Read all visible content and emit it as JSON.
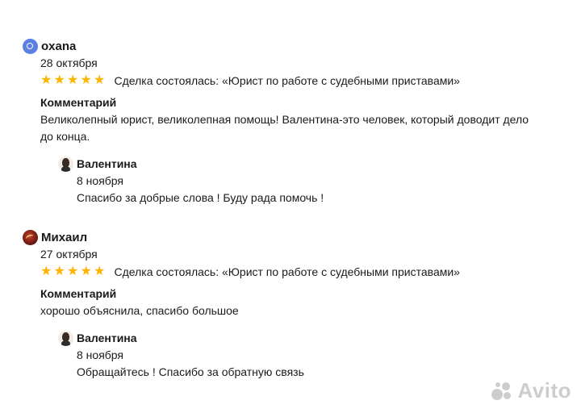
{
  "reviews": [
    {
      "author": "oxana",
      "avatar_icon": "letter-o-avatar",
      "date": "28 октября",
      "rating": 5,
      "stars": [
        "★",
        "★",
        "★",
        "★",
        "★"
      ],
      "deal": "Сделка состоялась: «Юрист по работе с судебными приставами»",
      "comment_title": "Комментарий",
      "comment": "Великолепный юрист, великолепная помощь! Валентина-это человек, который доводит дело до конца.",
      "reply": {
        "author": "Валентина",
        "date": "8 ноября",
        "text": "Спасибо за добрые слова ! Буду рада помочь !"
      }
    },
    {
      "author": "Михаил",
      "avatar_icon": "photo-avatar",
      "date": "27 октября",
      "rating": 5,
      "stars": [
        "★",
        "★",
        "★",
        "★",
        "★"
      ],
      "deal": "Сделка состоялась: «Юрист по работе с судебными приставами»",
      "comment_title": "Комментарий",
      "comment": "хорошо объяснила, спасибо большое",
      "reply": {
        "author": "Валентина",
        "date": "8 ноября",
        "text": "Обращайтесь ! Спасибо за обратную связь"
      }
    }
  ],
  "colors": {
    "star": "#ffb400",
    "text": "#1a1a1a",
    "watermark": "#c8c8c8"
  },
  "watermark": {
    "text": "Avito"
  }
}
